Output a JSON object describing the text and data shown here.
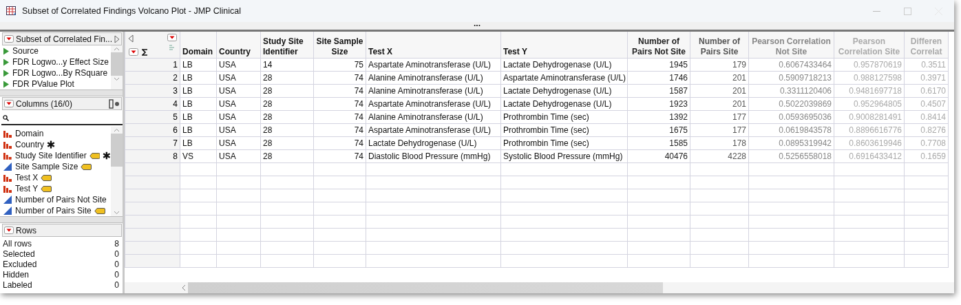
{
  "window": {
    "title": "Subset of Correlated Findings Volcano Plot - JMP Clinical",
    "more": "..."
  },
  "scripts_panel": {
    "title": "Subset of Correlated Fin...",
    "items": [
      "Source",
      "FDR Logwo...y Effect Size",
      "FDR Logwo...By RSquare",
      "FDR PValue Plot"
    ]
  },
  "columns_panel": {
    "title": "Columns (16/0)",
    "items": [
      {
        "name": "Domain",
        "kind": "nominal",
        "tagged": false,
        "linked": false
      },
      {
        "name": "Country",
        "kind": "nominal",
        "tagged": false,
        "linked": true
      },
      {
        "name": "Study Site Identifier",
        "kind": "nominal",
        "tagged": true,
        "linked": true
      },
      {
        "name": "Site Sample Size",
        "kind": "continuous",
        "tagged": true,
        "linked": false
      },
      {
        "name": "Test X",
        "kind": "nominal",
        "tagged": true,
        "linked": false
      },
      {
        "name": "Test Y",
        "kind": "nominal",
        "tagged": true,
        "linked": false
      },
      {
        "name": "Number of Pairs Not Site",
        "kind": "continuous",
        "tagged": false,
        "linked": false
      },
      {
        "name": "Number of Pairs Site",
        "kind": "continuous",
        "tagged": true,
        "linked": false
      }
    ]
  },
  "rows_panel": {
    "title": "Rows",
    "items": [
      {
        "label": "All rows",
        "count": "8"
      },
      {
        "label": "Selected",
        "count": "0"
      },
      {
        "label": "Excluded",
        "count": "0"
      },
      {
        "label": "Hidden",
        "count": "0"
      },
      {
        "label": "Labeled",
        "count": "0"
      }
    ]
  },
  "table": {
    "columns": [
      {
        "name": "Domain",
        "kind": "text"
      },
      {
        "name": "Country",
        "kind": "text"
      },
      {
        "name": "Study Site Identifier",
        "kind": "text"
      },
      {
        "name": "Site Sample Size",
        "kind": "number"
      },
      {
        "name": "Test X",
        "kind": "text"
      },
      {
        "name": "Test Y",
        "kind": "text"
      },
      {
        "name": "Number of Pairs Not Site",
        "kind": "number"
      },
      {
        "name": "Number of Pairs Site",
        "kind": "number"
      },
      {
        "name": "Pearson Correlation Not Site",
        "kind": "number"
      },
      {
        "name": "Pearson Correlation Site",
        "kind": "number"
      },
      {
        "name": "Differen Correlat",
        "kind": "number"
      }
    ],
    "rows": [
      {
        "number": "1",
        "cells": [
          "LB",
          "USA",
          "14",
          "75",
          "Aspartate Aminotransferase (U/L)",
          "Lactate Dehydrogenase (U/L)",
          "1945",
          "179",
          "0.6067433464",
          "0.957870619",
          "0.3511"
        ]
      },
      {
        "number": "2",
        "cells": [
          "LB",
          "USA",
          "28",
          "74",
          "Alanine Aminotransferase (U/L)",
          "Aspartate Aminotransferase (U/L)",
          "1746",
          "201",
          "0.5909718213",
          "0.988127598",
          "0.3971"
        ]
      },
      {
        "number": "3",
        "cells": [
          "LB",
          "USA",
          "28",
          "74",
          "Alanine Aminotransferase (U/L)",
          "Lactate Dehydrogenase (U/L)",
          "1587",
          "201",
          "0.3311120406",
          "0.9481697718",
          "0.6170"
        ]
      },
      {
        "number": "4",
        "cells": [
          "LB",
          "USA",
          "28",
          "74",
          "Aspartate Aminotransferase (U/L)",
          "Lactate Dehydrogenase (U/L)",
          "1923",
          "201",
          "0.5022039869",
          "0.952964805",
          "0.4507"
        ]
      },
      {
        "number": "5",
        "cells": [
          "LB",
          "USA",
          "28",
          "74",
          "Alanine Aminotransferase (U/L)",
          "Prothrombin Time (sec)",
          "1392",
          "177",
          "0.0593695036",
          "0.9008281491",
          "0.8414"
        ]
      },
      {
        "number": "6",
        "cells": [
          "LB",
          "USA",
          "28",
          "74",
          "Aspartate Aminotransferase (U/L)",
          "Prothrombin Time (sec)",
          "1675",
          "177",
          "0.0619843578",
          "0.8896616776",
          "0.8276"
        ]
      },
      {
        "number": "7",
        "cells": [
          "LB",
          "USA",
          "28",
          "74",
          "Lactate Dehydrogenase (U/L)",
          "Prothrombin Time (sec)",
          "1585",
          "178",
          "0.0895319942",
          "0.8603619946",
          "0.7708"
        ]
      },
      {
        "number": "8",
        "cells": [
          "VS",
          "USA",
          "28",
          "74",
          "Diastolic Blood Pressure (mmHg)",
          "Systolic Blood Pressure (mmHg)",
          "40476",
          "4228",
          "0.5256558018",
          "0.6916433412",
          "0.1659"
        ]
      }
    ]
  }
}
